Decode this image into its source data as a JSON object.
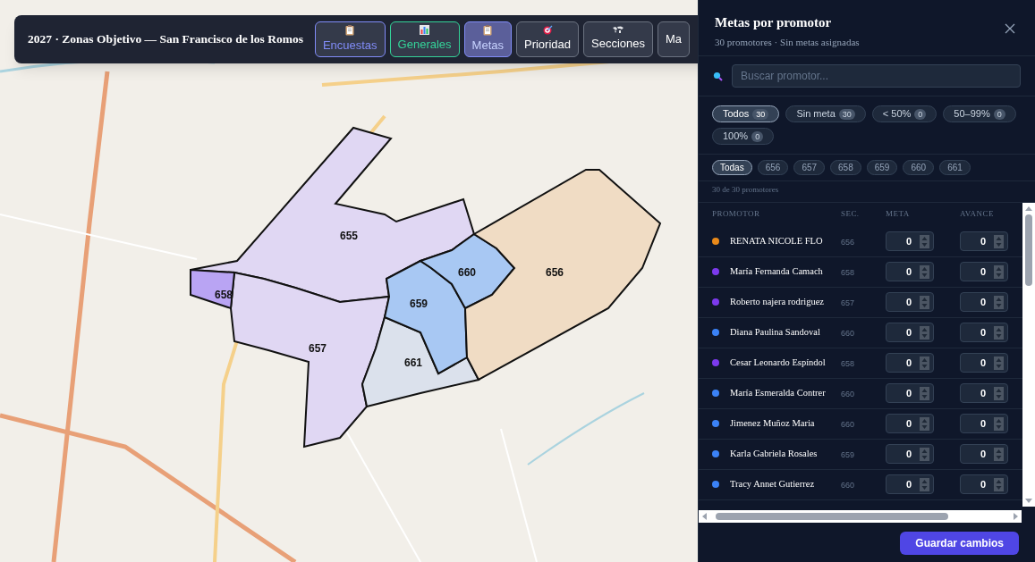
{
  "toolbar": {
    "title": "2027 · Zonas Objetivo — San Francisco de los Romos",
    "buttons": [
      {
        "label": "Encuestas",
        "kind": "clipboard",
        "color": "#818cf8",
        "selected": false
      },
      {
        "label": "Generales",
        "kind": "chart",
        "color": "#34d399",
        "selected": false
      },
      {
        "label": "Metas",
        "kind": "clipboard",
        "color": "#818cf8",
        "selected": true
      },
      {
        "label": "Prioridad",
        "kind": "target",
        "selected": false
      },
      {
        "label": "Secciones",
        "kind": "globe",
        "selected": false
      },
      {
        "label": "Ma",
        "kind": "none",
        "selected": false
      }
    ]
  },
  "map": {
    "sections": [
      {
        "label": "655",
        "color": "#e0d7f3"
      },
      {
        "label": "657",
        "color": "#e0d7f3"
      },
      {
        "label": "658",
        "color": "#b9a4f3"
      },
      {
        "label": "661",
        "color": "#dbe1ec"
      },
      {
        "label": "659",
        "color": "#a8c8f3"
      },
      {
        "label": "660",
        "color": "#a8c8f3"
      },
      {
        "label": "656",
        "color": "#f0dcc4"
      }
    ]
  },
  "panel": {
    "title": "Metas por promotor",
    "subtitle": "30 promotores · Sin metas asignadas",
    "search": {
      "placeholder": "Buscar promotor..."
    },
    "status_filters": [
      {
        "label": "Todos",
        "count": "30",
        "selected": true
      },
      {
        "label": "Sin meta",
        "count": "30",
        "selected": false
      },
      {
        "label": "< 50%",
        "count": "0",
        "selected": false
      },
      {
        "label": "50–99%",
        "count": "0",
        "selected": false
      },
      {
        "label": "100%",
        "count": "0",
        "selected": false
      }
    ],
    "section_filters": [
      {
        "label": "Todas",
        "selected": true
      },
      {
        "label": "656",
        "selected": false
      },
      {
        "label": "657",
        "selected": false
      },
      {
        "label": "658",
        "selected": false
      },
      {
        "label": "659",
        "selected": false
      },
      {
        "label": "660",
        "selected": false
      },
      {
        "label": "661",
        "selected": false
      }
    ],
    "result_count": "30 de 30 promotores",
    "columns": [
      "PROMOTOR",
      "SEC.",
      "META",
      "AVANCE"
    ],
    "rows": [
      {
        "name": "RENATA NICOLE FLO",
        "section": "656",
        "color": "#ea8a1a",
        "meta": "0",
        "avance": "0"
      },
      {
        "name": "María Fernanda Camach",
        "section": "658",
        "color": "#7c3aed",
        "meta": "0",
        "avance": "0"
      },
      {
        "name": "Roberto najera rodriguez",
        "section": "657",
        "color": "#7c3aed",
        "meta": "0",
        "avance": "0"
      },
      {
        "name": "Diana Paulina Sandoval",
        "section": "660",
        "color": "#3b82f6",
        "meta": "0",
        "avance": "0"
      },
      {
        "name": "Cesar Leonardo Espíndol",
        "section": "658",
        "color": "#7c3aed",
        "meta": "0",
        "avance": "0"
      },
      {
        "name": "María Esmeralda Contrer",
        "section": "660",
        "color": "#3b82f6",
        "meta": "0",
        "avance": "0"
      },
      {
        "name": "Jimenez Muñoz Maria",
        "section": "660",
        "color": "#3b82f6",
        "meta": "0",
        "avance": "0"
      },
      {
        "name": "Karla Gabriela Rosales",
        "section": "659",
        "color": "#3b82f6",
        "meta": "0",
        "avance": "0"
      },
      {
        "name": "Tracy Annet Gutierrez",
        "section": "660",
        "color": "#3b82f6",
        "meta": "0",
        "avance": "0"
      }
    ],
    "save_button": "Guardar cambios"
  }
}
